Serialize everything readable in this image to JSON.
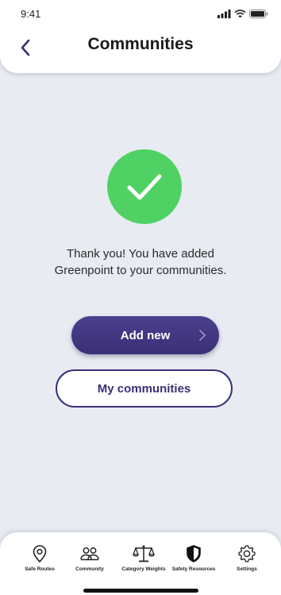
{
  "status_bar": {
    "time": "9:41"
  },
  "header": {
    "title": "Communities"
  },
  "message": {
    "line1": "Thank you! You have added",
    "line2": "Greenpoint to your communities."
  },
  "buttons": {
    "add_new": "Add new",
    "my_communities": "My communities"
  },
  "tabs": [
    {
      "label": "Safe Routes",
      "icon": "map-pin-icon"
    },
    {
      "label": "Community",
      "icon": "people-icon"
    },
    {
      "label": "Category Weights",
      "icon": "scale-icon"
    },
    {
      "label": "Safety Resources",
      "icon": "shield-icon"
    },
    {
      "label": "Settings",
      "icon": "gear-icon"
    }
  ],
  "colors": {
    "accent": "#3b2f75",
    "success": "#4fd263",
    "background": "#e8ebf2"
  }
}
